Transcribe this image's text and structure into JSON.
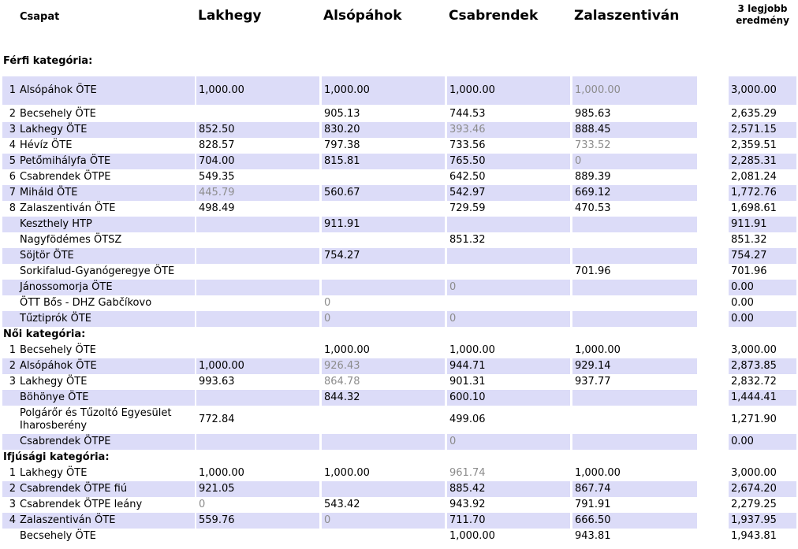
{
  "header": {
    "team": "Csapat",
    "locations": [
      "Lakhegy",
      "Alsópáhok",
      "Csabrendek",
      "Zalaszentiván"
    ],
    "best_line1": "3 legjobb",
    "best_line2": "eredmény"
  },
  "categories": [
    {
      "title": "Férfi kategória:",
      "rows": [
        {
          "rank": "1",
          "team": "Alsópáhok ÖTE",
          "scores": [
            "1,000.00",
            "1,000.00",
            "1,000.00",
            "1,000.00"
          ],
          "dim": [
            false,
            false,
            false,
            true
          ],
          "best": "3,000.00",
          "shade": true
        },
        {
          "rank": "2",
          "team": "Becsehely ÖTE",
          "scores": [
            "",
            "905.13",
            "744.53",
            "985.63"
          ],
          "dim": [
            false,
            false,
            false,
            false
          ],
          "best": "2,635.29",
          "shade": false
        },
        {
          "rank": "3",
          "team": "Lakhegy ÖTE",
          "scores": [
            "852.50",
            "830.20",
            "393.46",
            "888.45"
          ],
          "dim": [
            false,
            false,
            true,
            false
          ],
          "best": "2,571.15",
          "shade": true
        },
        {
          "rank": "4",
          "team": "Hévíz ÖTE",
          "scores": [
            "828.57",
            "797.38",
            "733.56",
            "733.52"
          ],
          "dim": [
            false,
            false,
            false,
            true
          ],
          "best": "2,359.51",
          "shade": false
        },
        {
          "rank": "5",
          "team": "Petőmihályfa ÖTE",
          "scores": [
            "704.00",
            "815.81",
            "765.50",
            "0"
          ],
          "dim": [
            false,
            false,
            false,
            true
          ],
          "best": "2,285.31",
          "shade": true
        },
        {
          "rank": "6",
          "team": "Csabrendek ÖTPE",
          "scores": [
            "549.35",
            "",
            "642.50",
            "889.39"
          ],
          "dim": [
            false,
            false,
            false,
            false
          ],
          "best": "2,081.24",
          "shade": false
        },
        {
          "rank": "7",
          "team": "Miháld ÖTE",
          "scores": [
            "445.79",
            "560.67",
            "542.97",
            "669.12"
          ],
          "dim": [
            true,
            false,
            false,
            false
          ],
          "best": "1,772.76",
          "shade": true
        },
        {
          "rank": "8",
          "team": "Zalaszentiván ÖTE",
          "scores": [
            "498.49",
            "",
            "729.59",
            "470.53"
          ],
          "dim": [
            false,
            false,
            false,
            false
          ],
          "best": "1,698.61",
          "shade": false
        },
        {
          "rank": "",
          "team": "Keszthely HTP",
          "scores": [
            "",
            "911.91",
            "",
            ""
          ],
          "dim": [
            false,
            false,
            false,
            false
          ],
          "best": "911.91",
          "shade": true
        },
        {
          "rank": "",
          "team": "Nagyfödémes ÖTSZ",
          "scores": [
            "",
            "",
            "851.32",
            ""
          ],
          "dim": [
            false,
            false,
            false,
            false
          ],
          "best": "851.32",
          "shade": false
        },
        {
          "rank": "",
          "team": "Söjtör ÖTE",
          "scores": [
            "",
            "754.27",
            "",
            ""
          ],
          "dim": [
            false,
            false,
            false,
            false
          ],
          "best": "754.27",
          "shade": true
        },
        {
          "rank": "",
          "team": "Sorkifalud-Gyanógeregye ÖTE",
          "scores": [
            "",
            "",
            "",
            "701.96"
          ],
          "dim": [
            false,
            false,
            false,
            false
          ],
          "best": "701.96",
          "shade": false
        },
        {
          "rank": "",
          "team": "Jánossomorja ÖTE",
          "scores": [
            "",
            "",
            "0",
            ""
          ],
          "dim": [
            false,
            false,
            true,
            false
          ],
          "best": "0.00",
          "shade": true
        },
        {
          "rank": "",
          "team": "ÖTT Bős - DHZ Gabčíkovo",
          "scores": [
            "",
            "0",
            "",
            ""
          ],
          "dim": [
            false,
            true,
            false,
            false
          ],
          "best": "0.00",
          "shade": false
        },
        {
          "rank": "",
          "team": "Tűztiprók ÖTE",
          "scores": [
            "",
            "0",
            "0",
            ""
          ],
          "dim": [
            false,
            true,
            true,
            false
          ],
          "best": "0.00",
          "shade": true
        }
      ]
    },
    {
      "title": "Női kategória:",
      "rows": [
        {
          "rank": "1",
          "team": "Becsehely ÖTE",
          "scores": [
            "",
            "1,000.00",
            "1,000.00",
            "1,000.00"
          ],
          "dim": [
            false,
            false,
            false,
            false
          ],
          "best": "3,000.00",
          "shade": false
        },
        {
          "rank": "2",
          "team": "Alsópáhok ÖTE",
          "scores": [
            "1,000.00",
            "926.43",
            "944.71",
            "929.14"
          ],
          "dim": [
            false,
            true,
            false,
            false
          ],
          "best": "2,873.85",
          "shade": true
        },
        {
          "rank": "3",
          "team": "Lakhegy ÖTE",
          "scores": [
            "993.63",
            "864.78",
            "901.31",
            "937.77"
          ],
          "dim": [
            false,
            true,
            false,
            false
          ],
          "best": "2,832.72",
          "shade": false
        },
        {
          "rank": "",
          "team": "Böhönye ÖTE",
          "scores": [
            "",
            "844.32",
            "600.10",
            ""
          ],
          "dim": [
            false,
            false,
            false,
            false
          ],
          "best": "1,444.41",
          "shade": true
        },
        {
          "rank": "",
          "team": "Polgárőr és Tűzoltó Egyesület Iharosberény",
          "scores": [
            "772.84",
            "",
            "499.06",
            ""
          ],
          "dim": [
            false,
            false,
            false,
            false
          ],
          "best": "1,271.90",
          "shade": false
        },
        {
          "rank": "",
          "team": "Csabrendek ÖTPE",
          "scores": [
            "",
            "",
            "0",
            ""
          ],
          "dim": [
            false,
            false,
            true,
            false
          ],
          "best": "0.00",
          "shade": true
        }
      ]
    },
    {
      "title": "Ifjúsági kategória:",
      "rows": [
        {
          "rank": "1",
          "team": "Lakhegy ÖTE",
          "scores": [
            "1,000.00",
            "1,000.00",
            "961.74",
            "1,000.00"
          ],
          "dim": [
            false,
            false,
            true,
            false
          ],
          "best": "3,000.00",
          "shade": false
        },
        {
          "rank": "2",
          "team": "Csabrendek ÖTPE fiú",
          "scores": [
            "921.05",
            "",
            "885.42",
            "867.74"
          ],
          "dim": [
            false,
            false,
            false,
            false
          ],
          "best": "2,674.20",
          "shade": true
        },
        {
          "rank": "3",
          "team": "Csabrendek ÖTPE leány",
          "scores": [
            "0",
            "543.42",
            "943.92",
            "791.91"
          ],
          "dim": [
            true,
            false,
            false,
            false
          ],
          "best": "2,279.25",
          "shade": false
        },
        {
          "rank": "4",
          "team": "Zalaszentiván ÖTE",
          "scores": [
            "559.76",
            "0",
            "711.70",
            "666.50"
          ],
          "dim": [
            false,
            true,
            false,
            false
          ],
          "best": "1,937.95",
          "shade": true
        },
        {
          "rank": "",
          "team": "Becsehely ÖTE",
          "scores": [
            "",
            "",
            "1,000.00",
            "943.81"
          ],
          "dim": [
            false,
            false,
            false,
            false
          ],
          "best": "1,943.81",
          "shade": false
        }
      ]
    }
  ]
}
